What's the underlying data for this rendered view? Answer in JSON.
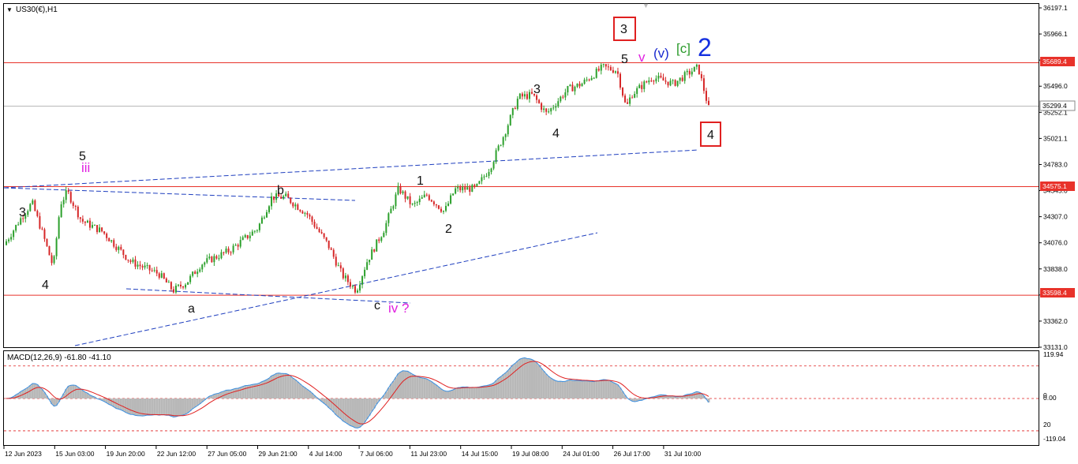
{
  "header": {
    "symbol_label": "US30(€),H1",
    "indicator_label": "MACD(12,26,9) -61.80 -41.10"
  },
  "colors": {
    "bull": "#2ca02c",
    "bear": "#d62728",
    "hline": "#e8322a",
    "trend": "#1f3fbf",
    "macd_signal": "#e02020",
    "macd_line": "#3a8fe0",
    "hist": "#b8b8b8",
    "cur": "#a0a0a0"
  },
  "price_axis": {
    "ticks": [
      "36197.1",
      "35966.1",
      "35727.0",
      "35496.0",
      "35252.1",
      "35021.1",
      "34783.0",
      "34545.0",
      "34307.0",
      "34076.0",
      "33838.0",
      "33600.0",
      "33362.0",
      "33131.0"
    ]
  },
  "price_labels": {
    "h1": "35689.4",
    "cur": "35299.4",
    "h2": "34575.1",
    "h3": "33598.4"
  },
  "macd_axis": {
    "ticks": [
      "119.94",
      "0",
      "0.00",
      "-119.04",
      "20"
    ]
  },
  "time_axis": {
    "labels": [
      "12 Jun 2023",
      "15 Jun 03:00",
      "19 Jun 20:00",
      "22 Jun 12:00",
      "27 Jun 05:00",
      "29 Jun 21:00",
      "4 Jul 14:00",
      "7 Jul 06:00",
      "11 Jul 23:00",
      "14 Jul 15:00",
      "19 Jul 08:00",
      "24 Jul 01:00",
      "26 Jul 17:00",
      "31 Jul 10:00"
    ]
  },
  "waves": {
    "w3a": "3",
    "w4a": "4",
    "w5a": "5",
    "iii": "iii",
    "a": "a",
    "b": "b",
    "c": "c",
    "iv": "iv ?",
    "w1": "1",
    "w2": "2",
    "w3b": "3",
    "w4b": "4",
    "w5b": "5",
    "v": "v",
    "v_paren": "(v)",
    "c_bracket": "[c]",
    "big2": "2",
    "box3": "3",
    "box4": "4"
  },
  "chart_data": {
    "type": "candlestick",
    "symbol": "US30(€)",
    "timeframe": "H1",
    "ylim": [
      33131.0,
      36197.1
    ],
    "horizontal_levels": [
      35689.4,
      34575.1,
      33598.4
    ],
    "current_price": 35299.4,
    "path": [
      [
        0,
        34050
      ],
      [
        2.5,
        34300
      ],
      [
        4,
        34430
      ],
      [
        5.5,
        34150
      ],
      [
        7,
        33850
      ],
      [
        8,
        34420
      ],
      [
        9,
        34530
      ],
      [
        11,
        34270
      ],
      [
        14,
        34170
      ],
      [
        18,
        33900
      ],
      [
        22,
        33790
      ],
      [
        24,
        33640
      ],
      [
        26,
        33720
      ],
      [
        28,
        33880
      ],
      [
        32,
        34000
      ],
      [
        36,
        34200
      ],
      [
        38,
        34480
      ],
      [
        40,
        34480
      ],
      [
        43,
        34330
      ],
      [
        46,
        34050
      ],
      [
        48,
        33780
      ],
      [
        50,
        33640
      ],
      [
        51.5,
        33900
      ],
      [
        54,
        34200
      ],
      [
        56,
        34560
      ],
      [
        58,
        34400
      ],
      [
        60,
        34500
      ],
      [
        62.5,
        34350
      ],
      [
        64,
        34550
      ],
      [
        67,
        34560
      ],
      [
        69,
        34750
      ],
      [
        71,
        35050
      ],
      [
        73,
        35380
      ],
      [
        75,
        35400
      ],
      [
        77,
        35230
      ],
      [
        80,
        35450
      ],
      [
        82,
        35500
      ],
      [
        85,
        35650
      ],
      [
        87,
        35620
      ],
      [
        88.3,
        35280
      ],
      [
        89,
        35400
      ],
      [
        92,
        35560
      ],
      [
        95,
        35500
      ],
      [
        97,
        35590
      ],
      [
        98.5,
        35650
      ],
      [
        100,
        35280
      ]
    ],
    "macd": {
      "name": "MACD(12,26,9)",
      "main": -61.8,
      "signal": -41.1,
      "levels": [
        119.94,
        0.0,
        -119.04
      ]
    }
  }
}
